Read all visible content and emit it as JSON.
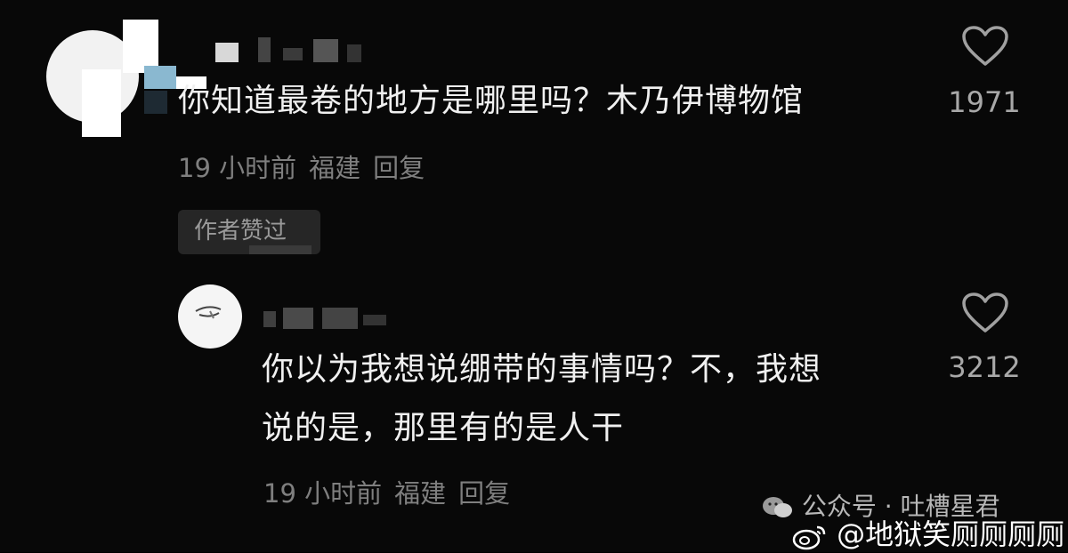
{
  "colors": {
    "background": "#080808",
    "text_primary": "#f0f0f0",
    "text_meta": "#7f7f7f",
    "count": "#a8a8a8"
  },
  "comments": [
    {
      "text": "你知道最卷的地方是哪里吗？木乃伊博物馆",
      "time": "19 小时前",
      "location": "福建",
      "reply_label": "回复",
      "author_liked_badge": "作者赞过",
      "like_icon": "heart-outline-icon",
      "like_count": "1971"
    }
  ],
  "reply": {
    "text_line1": "你以为我想说绷带的事情吗？不，我想",
    "text_line2": "说的是，那里有的是人干",
    "time": "19 小时前",
    "location": "福建",
    "reply_label": "回复",
    "like_icon": "heart-outline-icon",
    "like_count": "3212"
  },
  "watermarks": {
    "wechat_public": "公众号 · 吐槽星君",
    "weibo": "@地狱笑厕厕厕厕"
  }
}
